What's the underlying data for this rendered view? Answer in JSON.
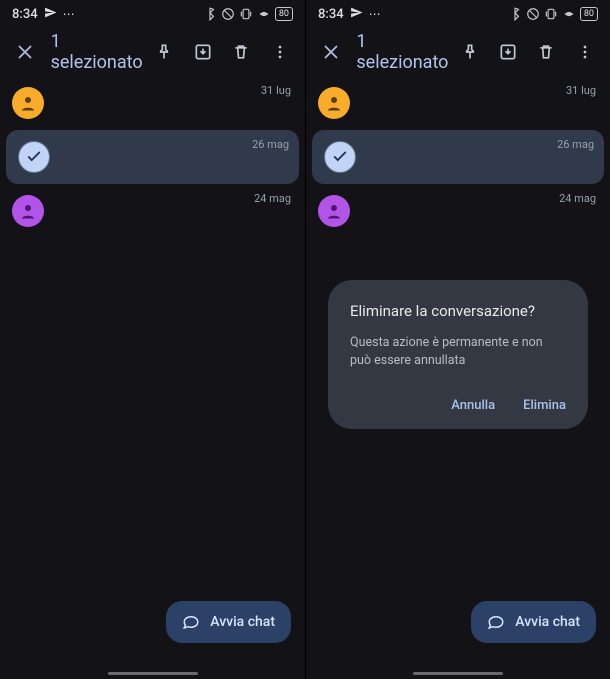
{
  "status": {
    "time": "8:34",
    "battery_label": "80"
  },
  "actionbar": {
    "title": "1 selezionato"
  },
  "conversations": [
    {
      "date": "31 lug",
      "avatar": "orange",
      "selected": false
    },
    {
      "date": "26 mag",
      "avatar": "check",
      "selected": true
    },
    {
      "date": "24 mag",
      "avatar": "purple",
      "selected": false
    }
  ],
  "fab": {
    "label": "Avvia chat"
  },
  "dialog": {
    "title": "Eliminare la conversazione?",
    "body": "Questa azione è permanente e non può essere annullata",
    "cancel": "Annulla",
    "confirm": "Elimina"
  }
}
